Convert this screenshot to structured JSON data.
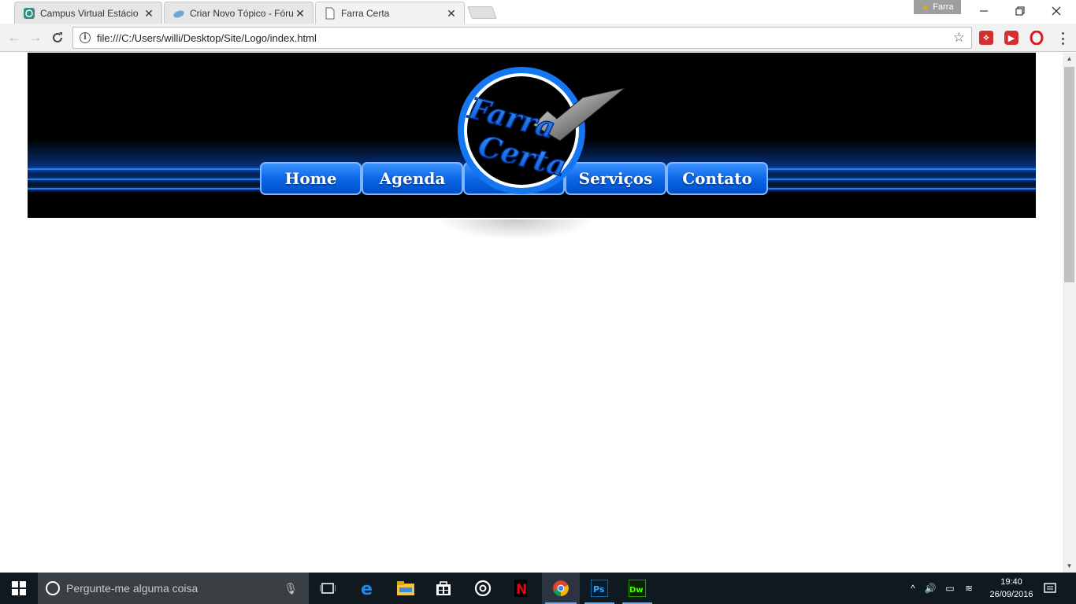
{
  "browser": {
    "tabs": [
      {
        "title": "Campus Virtual Estácio",
        "active": false
      },
      {
        "title": "Criar Novo Tópico - Fórum",
        "active": false
      },
      {
        "title": "Farra Certa",
        "active": true
      }
    ],
    "profile_name": "Farra",
    "url": "file:///C:/Users/willi/Desktop/Site/Logo/index.html"
  },
  "site": {
    "logo_line1": "Farra",
    "logo_line2": "Certa",
    "nav": [
      "Home",
      "Agenda",
      "",
      "Serviços",
      "Contato"
    ],
    "colors": {
      "accent": "#1e7bff",
      "button": "#0b66e8",
      "banner_bg": "#000000"
    }
  },
  "taskbar": {
    "search_placeholder": "Pergunte-me alguma coisa",
    "time": "19:40",
    "date": "26/09/2016"
  }
}
